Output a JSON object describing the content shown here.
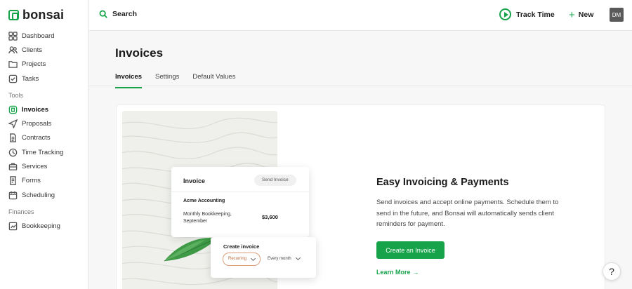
{
  "app": {
    "logo_text": "bonsai"
  },
  "sidebar": {
    "items": [
      {
        "label": "Dashboard",
        "icon": "grid-icon"
      },
      {
        "label": "Clients",
        "icon": "users-icon"
      },
      {
        "label": "Projects",
        "icon": "folder-icon"
      },
      {
        "label": "Tasks",
        "icon": "checkbox-icon"
      }
    ],
    "tools_label": "Tools",
    "tools": [
      {
        "label": "Invoices",
        "icon": "invoice-icon",
        "active": true
      },
      {
        "label": "Proposals",
        "icon": "send-icon"
      },
      {
        "label": "Contracts",
        "icon": "document-icon"
      },
      {
        "label": "Time Tracking",
        "icon": "clock-icon"
      },
      {
        "label": "Services",
        "icon": "briefcase-icon"
      },
      {
        "label": "Forms",
        "icon": "form-icon"
      },
      {
        "label": "Scheduling",
        "icon": "calendar-icon"
      }
    ],
    "finances_label": "Finances",
    "finances": [
      {
        "label": "Bookkeeping",
        "icon": "ledger-icon"
      }
    ]
  },
  "topbar": {
    "search_label": "Search",
    "track_time_label": "Track Time",
    "new_label": "New",
    "avatar_initials": "DM"
  },
  "page": {
    "title": "Invoices",
    "tabs": [
      {
        "label": "Invoices",
        "active": true
      },
      {
        "label": "Settings"
      },
      {
        "label": "Default Values"
      }
    ]
  },
  "illustration": {
    "invoice_title": "Invoice",
    "send_button": "Send Invoice",
    "client": "Acme Accounting",
    "description": "Monthly Bookkeeping, September",
    "amount": "$3,600",
    "create_title": "Create invoice",
    "recurring_label": "Recurring",
    "frequency_label": "Every month"
  },
  "hero": {
    "title": "Easy Invoicing & Payments",
    "text": "Send invoices and accept online payments. Schedule them to send in the future, and Bonsai will automatically sends client reminders for payment.",
    "cta_label": "Create an Invoice",
    "learn_more_label": "Learn More"
  },
  "help": {
    "label": "?"
  },
  "colors": {
    "accent": "#16a34a",
    "recurring": "#d99f7b"
  }
}
